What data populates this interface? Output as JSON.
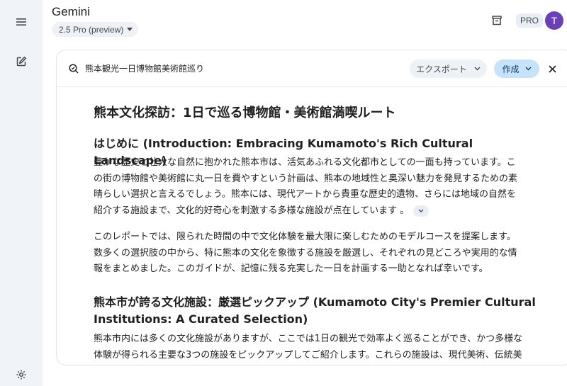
{
  "app": {
    "title": "Gemini"
  },
  "model_selector": {
    "label": "2.5 Pro (preview)"
  },
  "header": {
    "pro_badge": "PRO",
    "avatar_initial": "T"
  },
  "document": {
    "name": "熊本観光一日博物館美術館巡り",
    "export_label": "エクスポート",
    "create_label": "作成",
    "title": "熊本文化探訪：1日で巡る博物館・美術館満喫ルート",
    "sections": [
      {
        "heading": "はじめに (Introduction: Embracing Kumamoto's Rich Cultural Landscape)",
        "paragraphs": [
          [
            "豊かな歴史と壮大な自然に抱かれた熊本市は、活気あふれる文化都市としての一面も持っています。こ",
            "の街の博物館や美術館に丸一日を費やすという計画は、熊本の地域性と奥深い魅力を発見するための素",
            "晴らしい選択と言えるでしょう。熊本には、現代アートから貴重な歴史的遺物、さらには地域の自然を",
            "紹介する施設まで、文化的好奇心を刺激する多様な施設が点在しています 。"
          ],
          [
            "このレポートでは、限られた時間の中で文化体験を最大限に楽しむためのモデルコースを提案します。",
            "数多くの選択肢の中から、特に熊本の文化を象徴する施設を厳選し、それぞれの見どころや実用的な情",
            "報をまとめました。このガイドが、記憶に残る充実した一日を計画する一助となれば幸いです。"
          ]
        ]
      },
      {
        "heading_lines": [
          "熊本市が誇る文化施設：厳選ピックアップ (Kumamoto City's Premier Cultural",
          "Institutions: A Curated Selection)"
        ],
        "paragraphs": [
          [
            "熊本市内には多くの文化施設がありますが、ここでは1日の観光で効率よく巡ることができ、かつ多様な",
            "体験が得られる主要な3つの施設をピックアップしてご紹介します。これらの施設は、現代美術、伝統美"
          ]
        ]
      }
    ]
  },
  "colors": {
    "avatar": "#6b3fb5",
    "create_button": "#c7e2fb",
    "background": "#f0f4f9"
  }
}
